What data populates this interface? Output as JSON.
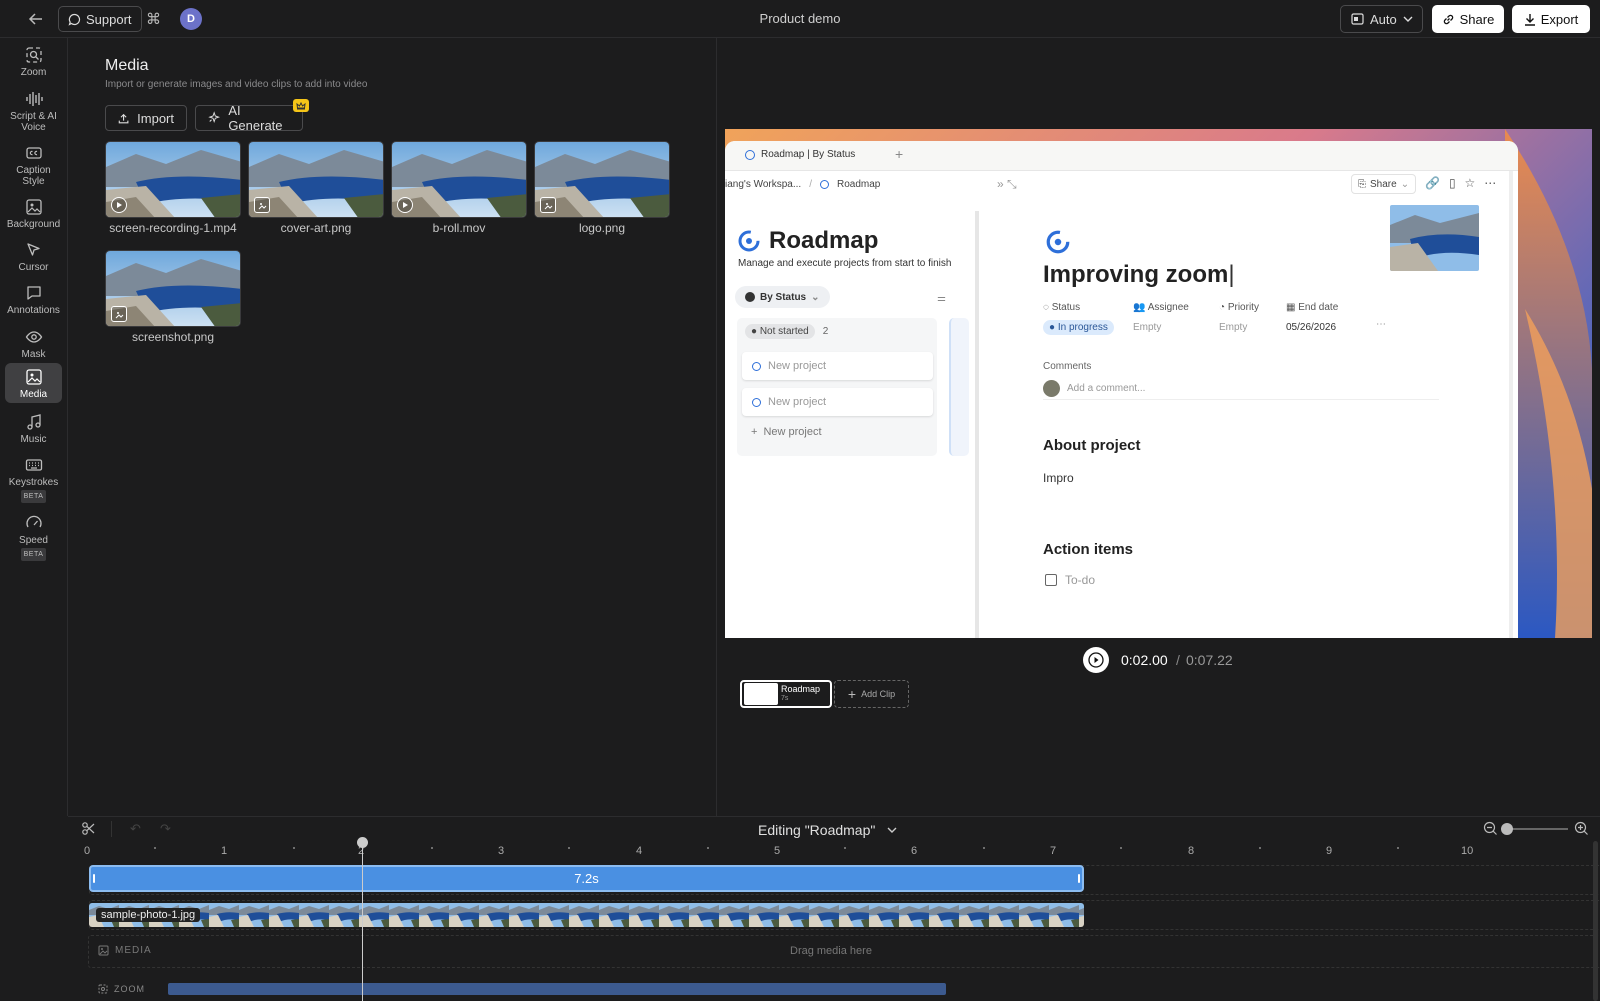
{
  "topbar": {
    "support": "Support",
    "avatar": "D",
    "title": "Product demo",
    "auto": "Auto",
    "share": "Share",
    "export": "Export"
  },
  "sidebar": {
    "items": [
      {
        "label": "Zoom",
        "icon": "zoom-icon"
      },
      {
        "label": "Script & AI Voice",
        "icon": "waveform-icon"
      },
      {
        "label": "Caption Style",
        "icon": "caption-icon"
      },
      {
        "label": "Background",
        "icon": "image-icon"
      },
      {
        "label": "Cursor",
        "icon": "cursor-icon"
      },
      {
        "label": "Annotations",
        "icon": "comment-icon"
      },
      {
        "label": "Mask",
        "icon": "eye-icon"
      },
      {
        "label": "Media",
        "icon": "media-icon"
      },
      {
        "label": "Music",
        "icon": "music-icon"
      },
      {
        "label": "Keystrokes",
        "icon": "keyboard-icon",
        "badge": "BETA"
      },
      {
        "label": "Speed",
        "icon": "gauge-icon",
        "badge": "BETA"
      }
    ],
    "active": "Media"
  },
  "media": {
    "title": "Media",
    "subtitle": "Import or generate images and video clips to add into video",
    "import": "Import",
    "ai_generate": "AI Generate",
    "files": [
      {
        "name": "screen-recording-1.mp4",
        "kind": "video"
      },
      {
        "name": "cover-art.png",
        "kind": "image"
      },
      {
        "name": "b-roll.mov",
        "kind": "video"
      },
      {
        "name": "logo.png",
        "kind": "image"
      },
      {
        "name": "screenshot.png",
        "kind": "image"
      }
    ]
  },
  "preview": {
    "tab": "Roadmap | By Status",
    "crumb1": "iang's Workspa...",
    "crumb2": "Roadmap",
    "share": "Share",
    "roadmap_title": "Roadmap",
    "roadmap_desc": "Manage and execute projects from start to finish",
    "by_status": "By Status",
    "not_started": "Not started",
    "not_started_count": "2",
    "cards": [
      "New project",
      "New project"
    ],
    "add_new": "New project",
    "page_title": "Improving zoom",
    "props": [
      {
        "label": "Status",
        "value": "In progress"
      },
      {
        "label": "Assignee",
        "value": "Empty"
      },
      {
        "label": "Priority",
        "value": "Empty"
      },
      {
        "label": "End date",
        "value": "05/26/2026"
      }
    ],
    "comments_label": "Comments",
    "comment_placeholder": "Add a comment...",
    "about_heading": "About project",
    "about_text": "Impro",
    "action_heading": "Action items",
    "todo": "To-do"
  },
  "player": {
    "current": "0:02.00",
    "separator": "/",
    "total": "0:07.22"
  },
  "clips": {
    "clip_name": "Roadmap",
    "clip_dur": "7s",
    "add_clip": "Add Clip"
  },
  "timeline": {
    "editing": "Editing \"Roadmap\"",
    "ruler": [
      "0",
      "1",
      "2",
      "3",
      "4",
      "5",
      "6",
      "7",
      "8",
      "9",
      "10"
    ],
    "bar_label": "7.2s",
    "film_label": "sample-photo-1.jpg",
    "media_track": "MEDIA",
    "drag_hint": "Drag media here",
    "zoom_track": "ZOOM"
  },
  "colors": {
    "accent": "#4a90e2",
    "background": "#1c1c1d",
    "active_nav": "#404042"
  }
}
